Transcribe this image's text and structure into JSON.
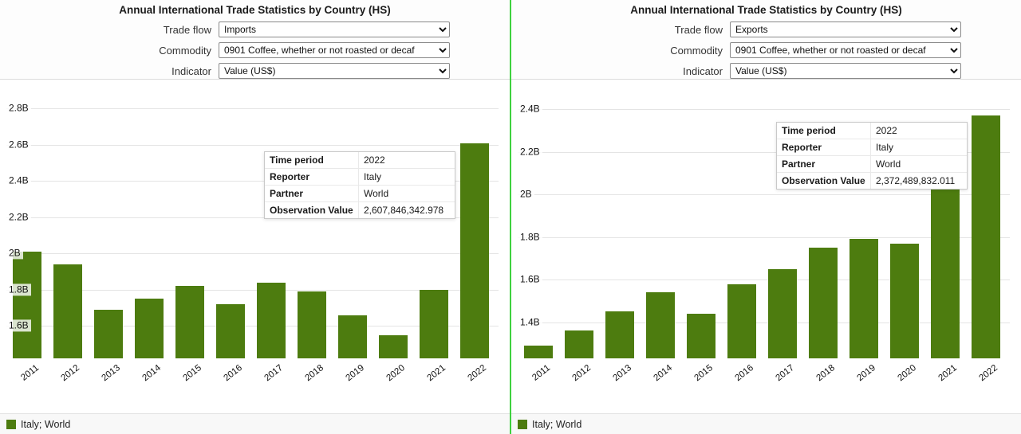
{
  "colors": {
    "bar": "#4d7c0f",
    "divider": "#3fd13f",
    "gridline": "#e4e4e4"
  },
  "panels": [
    {
      "title": "Annual International Trade Statistics by Country (HS)",
      "controls": [
        {
          "label": "Trade flow",
          "value": "Imports"
        },
        {
          "label": "Commodity",
          "value": "0901 Coffee, whether or not roasted or decaf"
        },
        {
          "label": "Indicator",
          "value": "Value (US$)"
        }
      ],
      "tooltip": [
        {
          "label": "Time period",
          "value": "2022"
        },
        {
          "label": "Reporter",
          "value": "Italy"
        },
        {
          "label": "Partner",
          "value": "World"
        },
        {
          "label": "Observation Value",
          "value": "2,607,846,342.978"
        }
      ],
      "legend": "Italy; World"
    },
    {
      "title": "Annual International Trade Statistics by Country (HS)",
      "controls": [
        {
          "label": "Trade flow",
          "value": "Exports"
        },
        {
          "label": "Commodity",
          "value": "0901 Coffee, whether or not roasted or decaf"
        },
        {
          "label": "Indicator",
          "value": "Value (US$)"
        }
      ],
      "tooltip": [
        {
          "label": "Time period",
          "value": "2022"
        },
        {
          "label": "Reporter",
          "value": "Italy"
        },
        {
          "label": "Partner",
          "value": "World"
        },
        {
          "label": "Observation Value",
          "value": "2,372,489,832.011"
        }
      ],
      "legend": "Italy; World"
    }
  ],
  "chart_data": [
    {
      "type": "bar",
      "title": "Annual International Trade Statistics by Country (HS) — Imports, Value (US$)",
      "series_name": "Italy; World",
      "unit": "billion US$",
      "categories": [
        "2011",
        "2012",
        "2013",
        "2014",
        "2015",
        "2016",
        "2017",
        "2018",
        "2019",
        "2020",
        "2021",
        "2022"
      ],
      "values": [
        2.01,
        1.94,
        1.69,
        1.75,
        1.82,
        1.72,
        1.84,
        1.79,
        1.66,
        1.55,
        1.8,
        2.6078
      ],
      "ylim": [
        1.42,
        2.96
      ],
      "tick_values": [
        1.6,
        1.8,
        2.0,
        2.2,
        2.4,
        2.6,
        2.8
      ],
      "tick_labels": [
        "1.6B",
        "1.8B",
        "2B",
        "2.2B",
        "2.4B",
        "2.6B",
        "2.8B"
      ],
      "grid": true,
      "legend_position": "bottom-left"
    },
    {
      "type": "bar",
      "title": "Annual International Trade Statistics by Country (HS) — Exports, Value (US$)",
      "series_name": "Italy; World",
      "unit": "billion US$",
      "categories": [
        "2011",
        "2012",
        "2013",
        "2014",
        "2015",
        "2016",
        "2017",
        "2018",
        "2019",
        "2020",
        "2021",
        "2022"
      ],
      "values": [
        1.29,
        1.36,
        1.45,
        1.54,
        1.44,
        1.58,
        1.65,
        1.75,
        1.79,
        1.77,
        2.03,
        2.3725
      ],
      "ylim": [
        1.23,
        2.54
      ],
      "tick_values": [
        1.4,
        1.6,
        1.8,
        2.0,
        2.2,
        2.4
      ],
      "tick_labels": [
        "1.4B",
        "1.6B",
        "1.8B",
        "2B",
        "2.2B",
        "2.4B"
      ],
      "grid": true,
      "legend_position": "bottom-left"
    }
  ]
}
